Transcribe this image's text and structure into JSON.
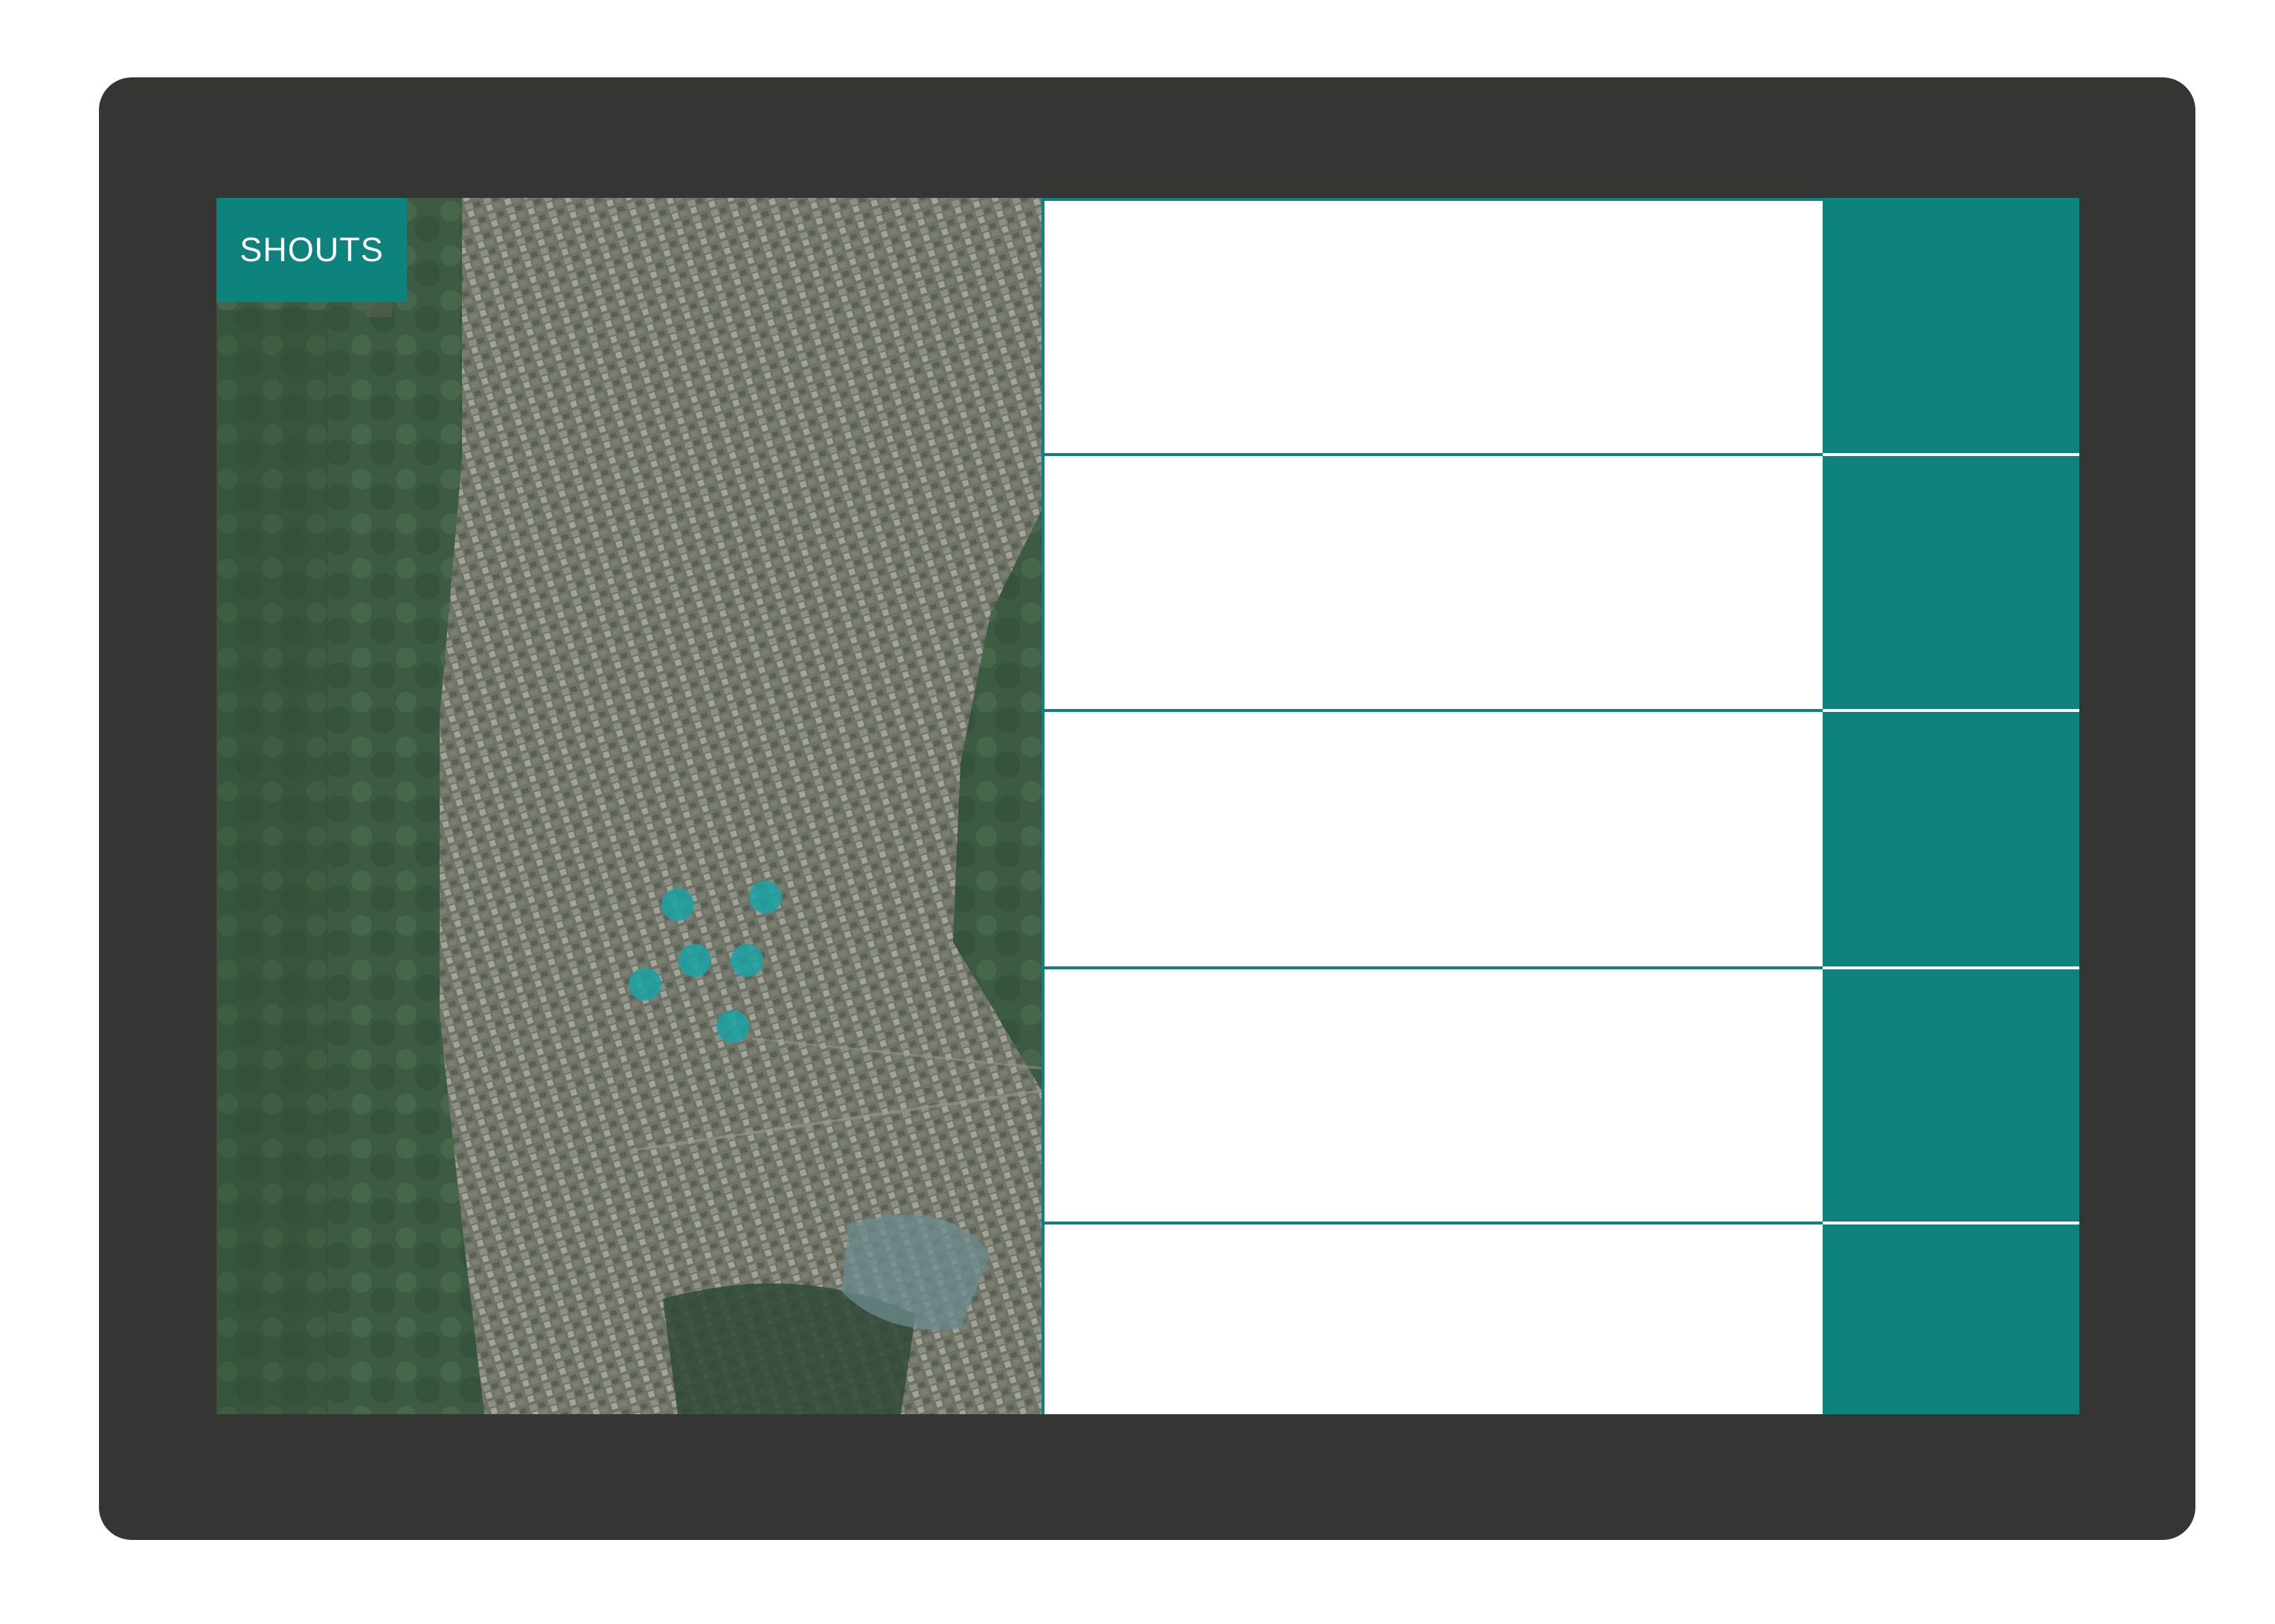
{
  "app": {
    "title": "SHOUTS"
  },
  "theme": {
    "accent": "#0e827d",
    "frame": "#353534",
    "marker": "#1aa3a6"
  },
  "map": {
    "type": "satellite",
    "markers": [
      {
        "id": 1
      },
      {
        "id": 2
      },
      {
        "id": 3
      },
      {
        "id": 4
      },
      {
        "id": 5
      },
      {
        "id": 6
      }
    ]
  },
  "feed": {
    "items": [
      {
        "id": 1
      },
      {
        "id": 2
      },
      {
        "id": 3
      },
      {
        "id": 4
      },
      {
        "id": 5
      }
    ]
  }
}
